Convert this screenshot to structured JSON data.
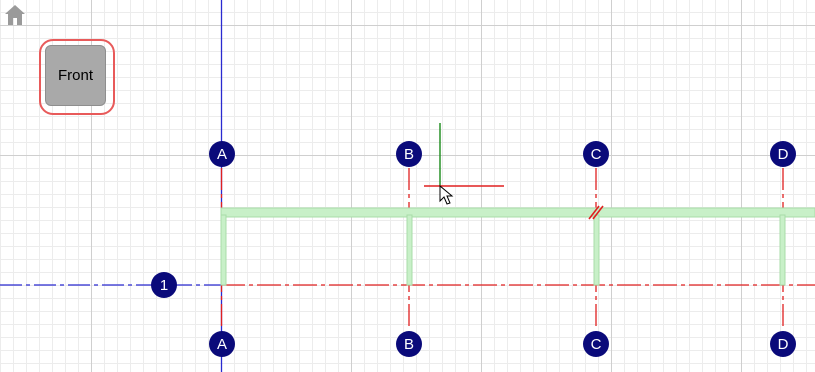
{
  "toolbar": {
    "home_icon": "home-icon",
    "view_button_label": "Front"
  },
  "grid_axes": {
    "vertical": [
      "A",
      "B",
      "C",
      "D"
    ],
    "horizontal": [
      "1"
    ]
  },
  "colors": {
    "axis_line": "#e02020",
    "blue_axis": "#2a2ad0",
    "green_axis": "#1a8a1a",
    "label_fill": "#0a0a7a",
    "beam": "#c8f0c8",
    "highlight_ring": "#e85a5a"
  }
}
